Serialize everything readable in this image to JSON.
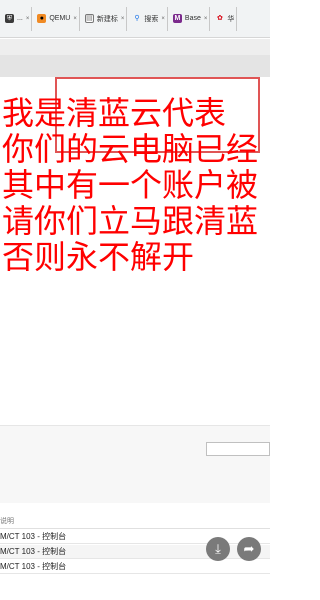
{
  "tabs": [
    {
      "label": "...",
      "icon": "shield-icon"
    },
    {
      "label": "QEMU",
      "icon": "qemu-icon"
    },
    {
      "label": "新建标",
      "icon": "page-icon"
    },
    {
      "label": "搜索",
      "icon": "search-icon"
    },
    {
      "label": "Base",
      "icon": "base-icon"
    },
    {
      "label": "华",
      "icon": "huawei-icon"
    }
  ],
  "tab_close_glyph": "×",
  "ransom_lines": [
    "我是清蓝云代表",
    "你们的云电脑已经",
    "其中有一个账户被",
    "请你们立马跟清蓝",
    "否则永不解开"
  ],
  "list": {
    "header": "说明",
    "rows": [
      "M/CT 103 - 控制台",
      "M/CT 103 - 控制台",
      "M/CT 103 - 控制台"
    ]
  },
  "fab_icons": [
    "download-icon",
    "share-icon"
  ],
  "colors": {
    "ransom_text": "#ff0000",
    "highlight_box": "#e05555"
  }
}
